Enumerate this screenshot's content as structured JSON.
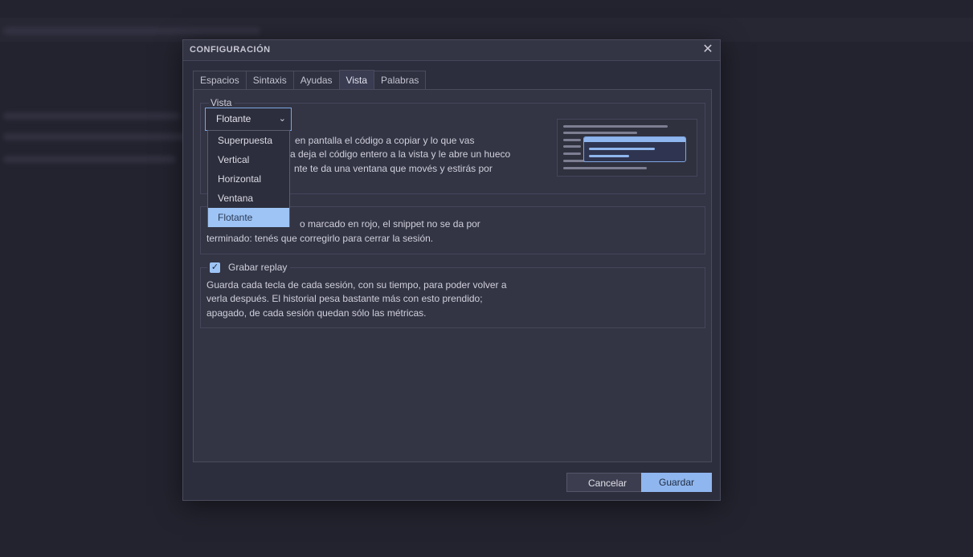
{
  "dialog": {
    "title": "CONFIGURACIÓN",
    "close_label": "✕"
  },
  "tabs": [
    {
      "label": "Espacios",
      "active": false
    },
    {
      "label": "Sintaxis",
      "active": false
    },
    {
      "label": "Ayudas",
      "active": false
    },
    {
      "label": "Vista",
      "active": true
    },
    {
      "label": "Palabras",
      "active": false
    }
  ],
  "vista": {
    "legend": "Vista",
    "select_value": "Flotante",
    "options": [
      "Superpuesta",
      "Vertical",
      "Horizontal",
      "Ventana",
      "Flotante"
    ],
    "selected_option": "Flotante",
    "desc_lines": [
      "en pantalla el código a copiar y lo que vas",
      "a deja el código entero a la vista y le abre un hueco",
      "nte te da una ventana que movés y estirás por"
    ]
  },
  "errors_group": {
    "desc_lines": [
      "o marcado en rojo, el snippet no se da por",
      "terminado: tenés que corregirlo para cerrar la sesión."
    ]
  },
  "replay": {
    "label": "Grabar replay",
    "checked": true,
    "desc_lines": [
      "Guarda cada tecla de cada sesión, con su tiempo, para poder volver a",
      "verla después. El historial pesa bastante más con esto prendido;",
      "apagado, de cada sesión quedan sólo las métricas."
    ]
  },
  "buttons": {
    "cancel": "Cancelar",
    "save": "Guardar"
  },
  "colors": {
    "accent": "#8fb6ee",
    "background": "#23232f",
    "dialog": "#2d2e3d"
  }
}
